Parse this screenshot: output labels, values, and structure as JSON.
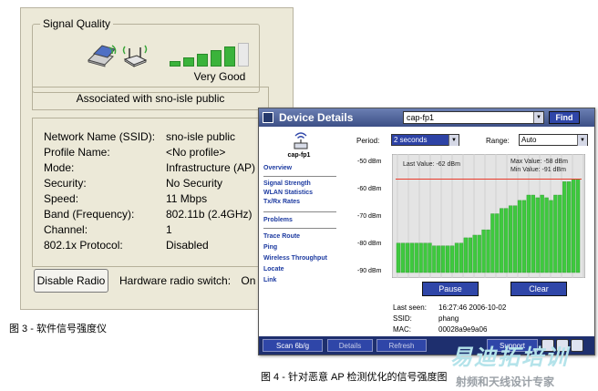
{
  "signal_dialog": {
    "group_title": "Signal Quality",
    "quality_text": "Very Good",
    "signal_level": {
      "filled": 5,
      "total": 6
    },
    "associated_text": "Associated with sno-isle public",
    "details": [
      {
        "label": "Network Name (SSID):",
        "value": "sno-isle public"
      },
      {
        "label": "Profile Name:",
        "value": "<No profile>"
      },
      {
        "label": "Mode:",
        "value": "Infrastructure (AP)"
      },
      {
        "label": "Security:",
        "value": "No Security"
      },
      {
        "label": "Speed:",
        "value": "11 Mbps"
      },
      {
        "label": "Band (Frequency):",
        "value": "802.11b (2.4GHz)"
      },
      {
        "label": "Channel:",
        "value": "1"
      },
      {
        "label": "802.1x Protocol:",
        "value": "Disabled"
      }
    ],
    "disable_radio_label": "Disable Radio",
    "hw_switch_label": "Hardware radio switch:",
    "hw_switch_value": "On"
  },
  "caption_fig3": "图 3 - 软件信号强度仪",
  "device_window": {
    "title": "Device Details",
    "selected_device": "cap-fp1",
    "find_label": "Find",
    "ap_name": "cap-fp1",
    "nav": {
      "overview": "Overview",
      "group1": [
        "Signal Strength",
        "WLAN Statistics",
        "Tx/Rx Rates"
      ],
      "problems": "Problems",
      "group2": [
        "Trace Route",
        "Ping",
        "Wireless Throughput",
        "Locate",
        "Link"
      ]
    },
    "period_label": "Period:",
    "period_value": "2 seconds",
    "range_label": "Range:",
    "range_value": "Auto",
    "last_value": "Last Value:  -62 dBm",
    "max_value": "Max Value:   -58 dBm",
    "min_value": "Min Value:   -91 dBm",
    "pause_label": "Pause",
    "clear_label": "Clear",
    "info": [
      {
        "label": "Last seen:",
        "value": "16:27:46 2006-10-02"
      },
      {
        "label": "SSID:",
        "value": "phang"
      },
      {
        "label": "MAC:",
        "value": "00028a9e9a06"
      }
    ],
    "bottom": {
      "scan": "Scan 6b/g",
      "details": "Details",
      "refresh": "Refresh",
      "support": "Support"
    },
    "colors": {
      "bars": "#3ec93e",
      "max_line": "#e83a2a",
      "chart_bg": "#e4e4e4",
      "accent": "#2f46a8"
    }
  },
  "chart_data": {
    "type": "bar",
    "ylabels": [
      "-50 dBm",
      "-60 dBm",
      "-70 dBm",
      "-80 dBm",
      "-90 dBm"
    ],
    "ylim": [
      -93,
      -50
    ],
    "values": [
      -82,
      -82,
      -82,
      -82,
      -82,
      -82,
      -82,
      -82,
      -83,
      -83,
      -83,
      -83,
      -83,
      -82,
      -82,
      -80,
      -80,
      -79,
      -79,
      -77,
      -77,
      -71,
      -71,
      -69,
      -69,
      -68,
      -68,
      -66,
      -66,
      -64,
      -64,
      -65,
      -64,
      -65,
      -66,
      -64,
      -64,
      -59,
      -59,
      -58,
      -58
    ],
    "max_value": -58,
    "min_value": -91,
    "last_value": -62,
    "grid": true
  },
  "caption_fig4": "图 4 - 针对恶意 AP 检测优化的信号强度图",
  "watermark": {
    "logo_text": "易迪拓培训",
    "subtitle": "射频和天线设计专家"
  }
}
